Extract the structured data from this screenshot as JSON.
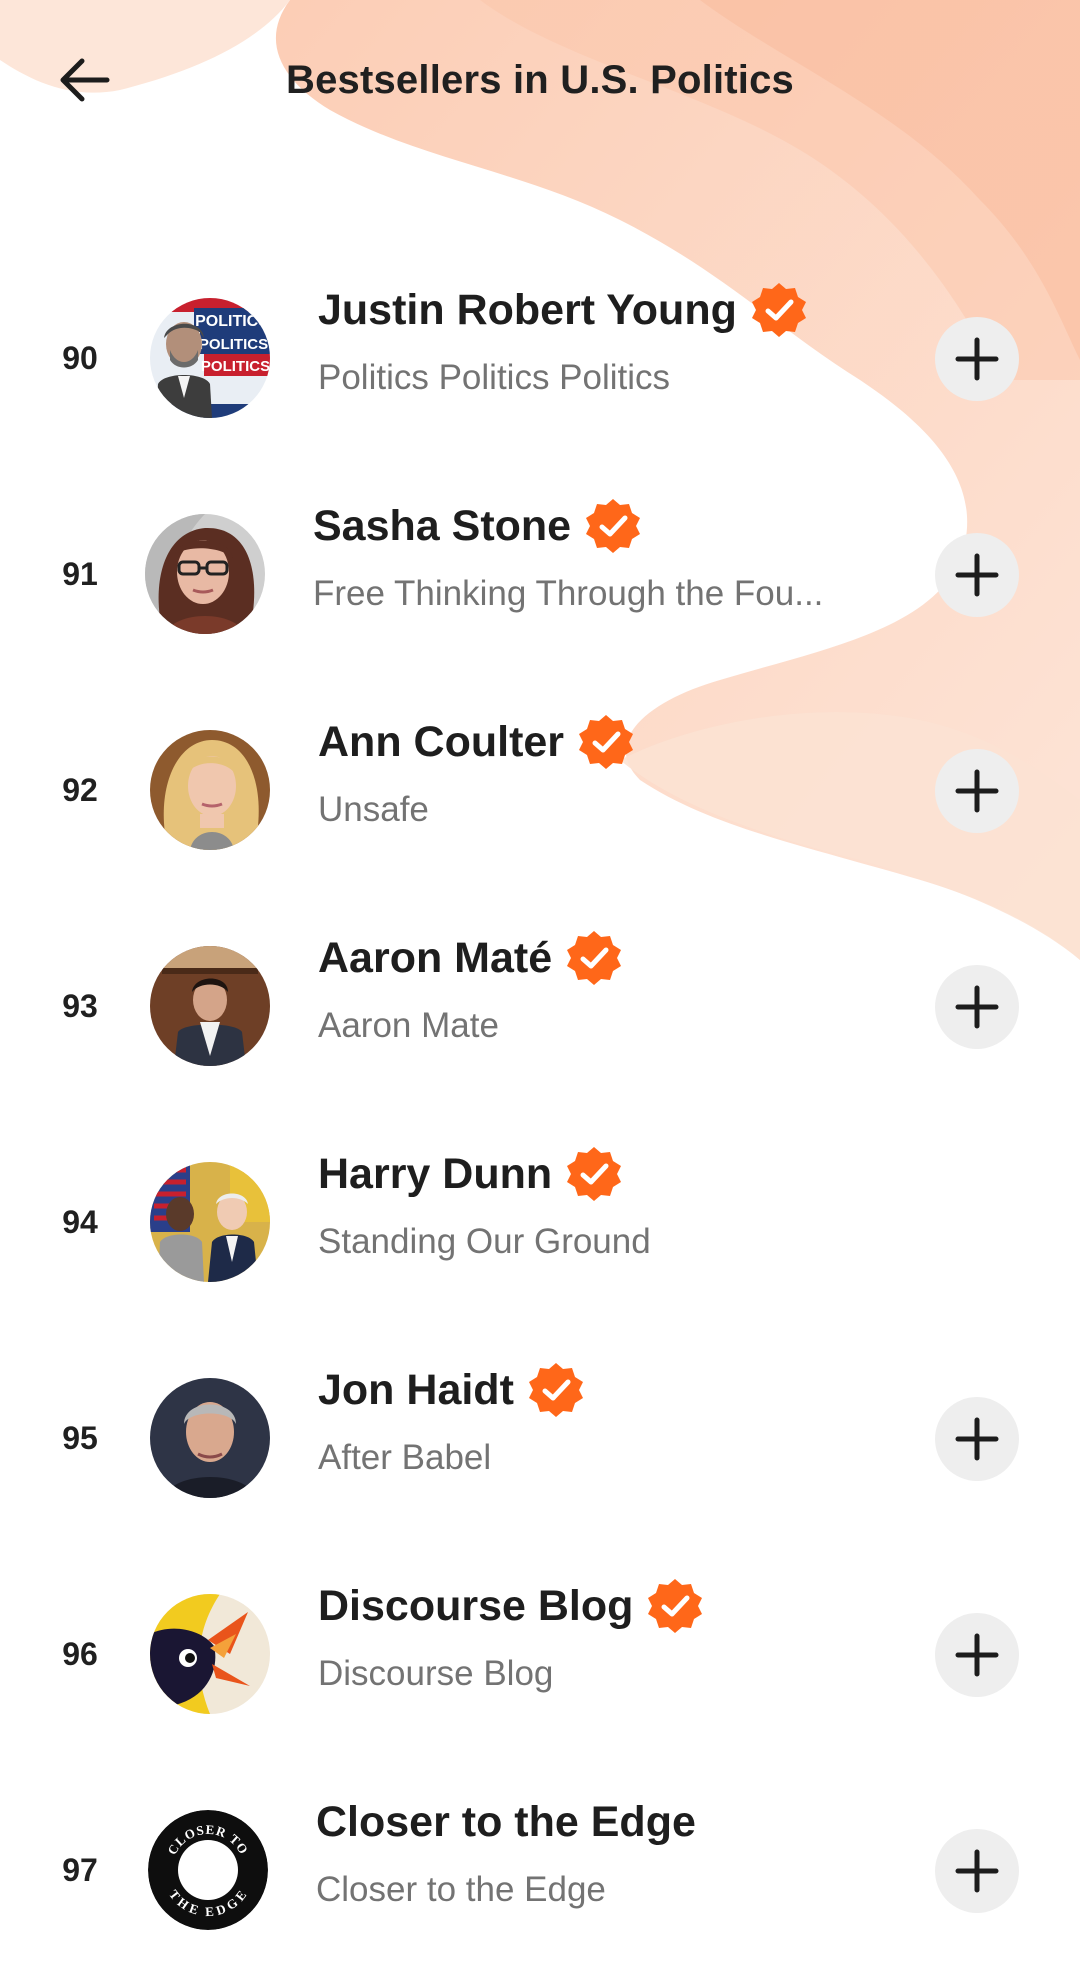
{
  "header": {
    "title": "Bestsellers in U.S. Politics",
    "back_icon": "arrow-left-icon"
  },
  "theme": {
    "accent": "#FF6719",
    "swirl": "#FBD3BD",
    "button_bg": "#EEEEEE",
    "subtitle": "#737373"
  },
  "items": [
    {
      "rank": "90",
      "name": "Justin Robert Young",
      "subtitle": "Politics Politics Politics",
      "verified": true,
      "follow_button": true,
      "avatar_text": [
        "POLITICS",
        "POLITICS!",
        "POLITICS!"
      ]
    },
    {
      "rank": "91",
      "name": "Sasha Stone",
      "subtitle": "Free Thinking Through the Fou...",
      "verified": true,
      "follow_button": true
    },
    {
      "rank": "92",
      "name": "Ann Coulter",
      "subtitle": "Unsafe",
      "verified": true,
      "follow_button": true
    },
    {
      "rank": "93",
      "name": "Aaron Maté",
      "subtitle": "Aaron Mate",
      "verified": true,
      "follow_button": true
    },
    {
      "rank": "94",
      "name": "Harry Dunn",
      "subtitle": "Standing Our Ground",
      "verified": true,
      "follow_button": false
    },
    {
      "rank": "95",
      "name": "Jon Haidt",
      "subtitle": "After Babel",
      "verified": true,
      "follow_button": true
    },
    {
      "rank": "96",
      "name": "Discourse Blog",
      "subtitle": "Discourse Blog",
      "verified": true,
      "follow_button": true
    },
    {
      "rank": "97",
      "name": "Closer to the Edge",
      "subtitle": "Closer to the Edge",
      "verified": false,
      "follow_button": true,
      "avatar_text": [
        "CLOSER TO",
        "THE EDGE"
      ]
    }
  ]
}
